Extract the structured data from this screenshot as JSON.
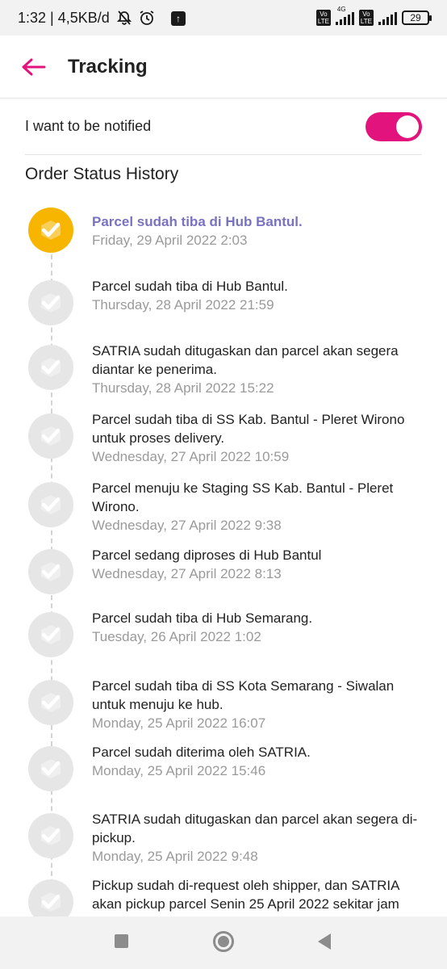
{
  "status_bar": {
    "time_speed": "1:32 | 4,5KB/d",
    "network_type": "4G",
    "volte_label": "Vo\nLTE",
    "battery": "29",
    "icons": [
      "bell-off-icon",
      "alarm-icon",
      "upload-icon",
      "volte-icon",
      "signal-icon",
      "battery-icon"
    ]
  },
  "header": {
    "title": "Tracking",
    "back_icon": "arrow-left-icon",
    "accent_color": "#e2137d"
  },
  "notify": {
    "label": "I want to be notified",
    "enabled": true
  },
  "section_title": "Order Status History",
  "colors": {
    "active_dot": "#f7b500",
    "active_text": "#7873c0",
    "inactive_dot": "#e6e6e6",
    "date_text": "#9a9a9a"
  },
  "history": [
    {
      "desc": "Parcel sudah tiba di Hub Bantul.",
      "date": "Friday, 29 April 2022 2:03",
      "active": true
    },
    {
      "desc": "Parcel sudah tiba di Hub Bantul.",
      "date": "Thursday, 28 April 2022 21:59",
      "active": false
    },
    {
      "desc": "SATRIA sudah ditugaskan dan parcel akan segera diantar ke penerima.",
      "date": "Thursday, 28 April 2022 15:22",
      "active": false
    },
    {
      "desc": "Parcel sudah tiba di SS Kab. Bantul - Pleret Wirono untuk proses delivery.",
      "date": "Wednesday, 27 April 2022 10:59",
      "active": false
    },
    {
      "desc": "Parcel menuju ke Staging SS Kab. Bantul - Pleret Wirono.",
      "date": "Wednesday, 27 April 2022 9:38",
      "active": false
    },
    {
      "desc": "Parcel sedang diproses di Hub Bantul",
      "date": "Wednesday, 27 April 2022 8:13",
      "active": false
    },
    {
      "desc": "Parcel sudah tiba di Hub Semarang.",
      "date": "Tuesday, 26 April 2022 1:02",
      "active": false
    },
    {
      "desc": "Parcel sudah tiba di SS Kota Semarang - Siwalan untuk menuju ke hub.",
      "date": "Monday, 25 April 2022 16:07",
      "active": false
    },
    {
      "desc": "Parcel sudah diterima oleh SATRIA.",
      "date": "Monday, 25 April 2022 15:46",
      "active": false
    },
    {
      "desc": "SATRIA sudah ditugaskan dan parcel akan segera di-pickup.",
      "date": "Monday, 25 April 2022 9:48",
      "active": false
    },
    {
      "desc": "Pickup sudah di-request oleh shipper, dan SATRIA akan pickup parcel Senin 25 April 2022 sekitar jam",
      "date": "",
      "active": false
    }
  ],
  "nav": {
    "icons": [
      "recent-apps-icon",
      "home-icon",
      "back-icon"
    ]
  }
}
